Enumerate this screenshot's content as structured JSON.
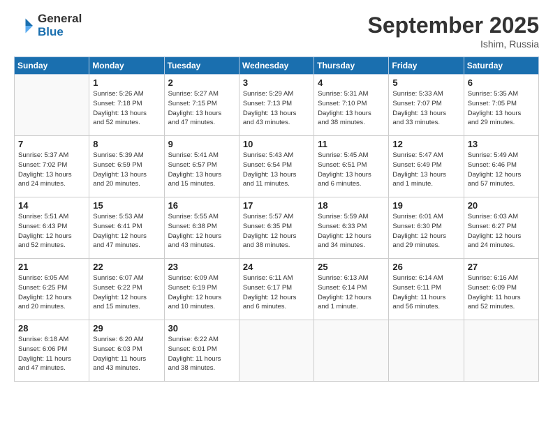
{
  "logo": {
    "general": "General",
    "blue": "Blue"
  },
  "header": {
    "month": "September 2025",
    "location": "Ishim, Russia"
  },
  "weekdays": [
    "Sunday",
    "Monday",
    "Tuesday",
    "Wednesday",
    "Thursday",
    "Friday",
    "Saturday"
  ],
  "weeks": [
    [
      {
        "day": "",
        "info": ""
      },
      {
        "day": "1",
        "info": "Sunrise: 5:26 AM\nSunset: 7:18 PM\nDaylight: 13 hours\nand 52 minutes."
      },
      {
        "day": "2",
        "info": "Sunrise: 5:27 AM\nSunset: 7:15 PM\nDaylight: 13 hours\nand 47 minutes."
      },
      {
        "day": "3",
        "info": "Sunrise: 5:29 AM\nSunset: 7:13 PM\nDaylight: 13 hours\nand 43 minutes."
      },
      {
        "day": "4",
        "info": "Sunrise: 5:31 AM\nSunset: 7:10 PM\nDaylight: 13 hours\nand 38 minutes."
      },
      {
        "day": "5",
        "info": "Sunrise: 5:33 AM\nSunset: 7:07 PM\nDaylight: 13 hours\nand 33 minutes."
      },
      {
        "day": "6",
        "info": "Sunrise: 5:35 AM\nSunset: 7:05 PM\nDaylight: 13 hours\nand 29 minutes."
      }
    ],
    [
      {
        "day": "7",
        "info": "Sunrise: 5:37 AM\nSunset: 7:02 PM\nDaylight: 13 hours\nand 24 minutes."
      },
      {
        "day": "8",
        "info": "Sunrise: 5:39 AM\nSunset: 6:59 PM\nDaylight: 13 hours\nand 20 minutes."
      },
      {
        "day": "9",
        "info": "Sunrise: 5:41 AM\nSunset: 6:57 PM\nDaylight: 13 hours\nand 15 minutes."
      },
      {
        "day": "10",
        "info": "Sunrise: 5:43 AM\nSunset: 6:54 PM\nDaylight: 13 hours\nand 11 minutes."
      },
      {
        "day": "11",
        "info": "Sunrise: 5:45 AM\nSunset: 6:51 PM\nDaylight: 13 hours\nand 6 minutes."
      },
      {
        "day": "12",
        "info": "Sunrise: 5:47 AM\nSunset: 6:49 PM\nDaylight: 13 hours\nand 1 minute."
      },
      {
        "day": "13",
        "info": "Sunrise: 5:49 AM\nSunset: 6:46 PM\nDaylight: 12 hours\nand 57 minutes."
      }
    ],
    [
      {
        "day": "14",
        "info": "Sunrise: 5:51 AM\nSunset: 6:43 PM\nDaylight: 12 hours\nand 52 minutes."
      },
      {
        "day": "15",
        "info": "Sunrise: 5:53 AM\nSunset: 6:41 PM\nDaylight: 12 hours\nand 47 minutes."
      },
      {
        "day": "16",
        "info": "Sunrise: 5:55 AM\nSunset: 6:38 PM\nDaylight: 12 hours\nand 43 minutes."
      },
      {
        "day": "17",
        "info": "Sunrise: 5:57 AM\nSunset: 6:35 PM\nDaylight: 12 hours\nand 38 minutes."
      },
      {
        "day": "18",
        "info": "Sunrise: 5:59 AM\nSunset: 6:33 PM\nDaylight: 12 hours\nand 34 minutes."
      },
      {
        "day": "19",
        "info": "Sunrise: 6:01 AM\nSunset: 6:30 PM\nDaylight: 12 hours\nand 29 minutes."
      },
      {
        "day": "20",
        "info": "Sunrise: 6:03 AM\nSunset: 6:27 PM\nDaylight: 12 hours\nand 24 minutes."
      }
    ],
    [
      {
        "day": "21",
        "info": "Sunrise: 6:05 AM\nSunset: 6:25 PM\nDaylight: 12 hours\nand 20 minutes."
      },
      {
        "day": "22",
        "info": "Sunrise: 6:07 AM\nSunset: 6:22 PM\nDaylight: 12 hours\nand 15 minutes."
      },
      {
        "day": "23",
        "info": "Sunrise: 6:09 AM\nSunset: 6:19 PM\nDaylight: 12 hours\nand 10 minutes."
      },
      {
        "day": "24",
        "info": "Sunrise: 6:11 AM\nSunset: 6:17 PM\nDaylight: 12 hours\nand 6 minutes."
      },
      {
        "day": "25",
        "info": "Sunrise: 6:13 AM\nSunset: 6:14 PM\nDaylight: 12 hours\nand 1 minute."
      },
      {
        "day": "26",
        "info": "Sunrise: 6:14 AM\nSunset: 6:11 PM\nDaylight: 11 hours\nand 56 minutes."
      },
      {
        "day": "27",
        "info": "Sunrise: 6:16 AM\nSunset: 6:09 PM\nDaylight: 11 hours\nand 52 minutes."
      }
    ],
    [
      {
        "day": "28",
        "info": "Sunrise: 6:18 AM\nSunset: 6:06 PM\nDaylight: 11 hours\nand 47 minutes."
      },
      {
        "day": "29",
        "info": "Sunrise: 6:20 AM\nSunset: 6:03 PM\nDaylight: 11 hours\nand 43 minutes."
      },
      {
        "day": "30",
        "info": "Sunrise: 6:22 AM\nSunset: 6:01 PM\nDaylight: 11 hours\nand 38 minutes."
      },
      {
        "day": "",
        "info": ""
      },
      {
        "day": "",
        "info": ""
      },
      {
        "day": "",
        "info": ""
      },
      {
        "day": "",
        "info": ""
      }
    ]
  ]
}
